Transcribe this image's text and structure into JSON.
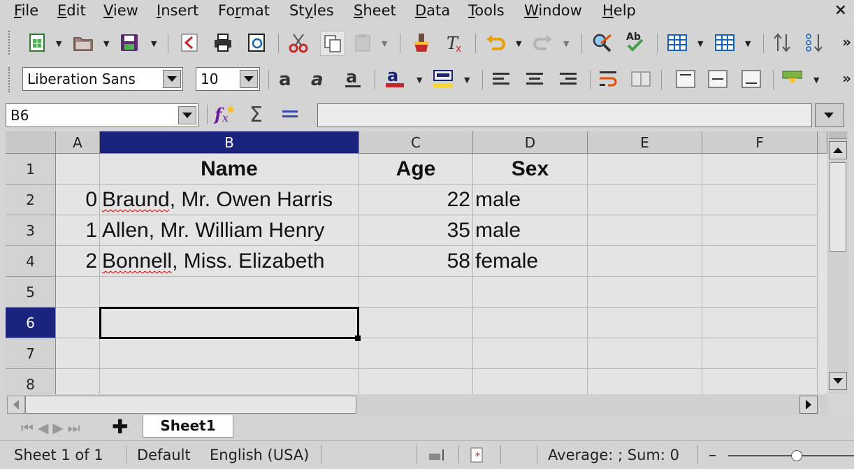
{
  "menu": {
    "items": [
      {
        "label": "File",
        "u": "F",
        "rest": "ile"
      },
      {
        "label": "Edit",
        "u": "E",
        "rest": "dit"
      },
      {
        "label": "View",
        "u": "V",
        "rest": "iew"
      },
      {
        "label": "Insert",
        "u": "I",
        "rest": "nsert"
      },
      {
        "label": "Format",
        "pre": "Fo",
        "u": "r",
        "rest": "mat"
      },
      {
        "label": "Styles",
        "pre": "St",
        "u": "y",
        "rest": "les"
      },
      {
        "label": "Sheet",
        "u": "S",
        "rest": "heet"
      },
      {
        "label": "Data",
        "u": "D",
        "rest": "ata"
      },
      {
        "label": "Tools",
        "u": "T",
        "rest": "ools"
      },
      {
        "label": "Window",
        "u": "W",
        "rest": "indow"
      },
      {
        "label": "Help",
        "u": "H",
        "rest": "elp"
      }
    ],
    "close": "×"
  },
  "format_bar": {
    "font_name": "Liberation Sans",
    "font_size": "10"
  },
  "formula_bar": {
    "name_box": "B6",
    "formula": ""
  },
  "grid": {
    "columns": [
      "A",
      "B",
      "C",
      "D",
      "E",
      "F"
    ],
    "selected_column": "B",
    "rows": [
      "1",
      "2",
      "3",
      "4",
      "5",
      "6",
      "7",
      "8"
    ],
    "selected_row": "6",
    "header": {
      "name": "Name",
      "age": "Age",
      "sex": "Sex"
    },
    "data": [
      {
        "index": "0",
        "name": "Braund, Mr. Owen Harris",
        "name_sq": "Braund",
        "name_rest": ", Mr. Owen Harris",
        "age": "22",
        "sex": "male"
      },
      {
        "index": "1",
        "name": "Allen, Mr. William Henry",
        "age": "35",
        "sex": "male"
      },
      {
        "index": "2",
        "name": "Bonnell, Miss. Elizabeth",
        "name_sq": "Bonnell",
        "name_rest": ", Miss. Elizabeth",
        "age": "58",
        "sex": "female"
      }
    ]
  },
  "tabs": {
    "sheet_tab": "Sheet1"
  },
  "status": {
    "sheet_pos": "Sheet 1 of 1",
    "page_style": "Default",
    "language": "English (USA)",
    "summary": "Average: ; Sum: 0"
  },
  "colors": {
    "selection_header": "#1a237e",
    "spell_error": "#d00000"
  }
}
